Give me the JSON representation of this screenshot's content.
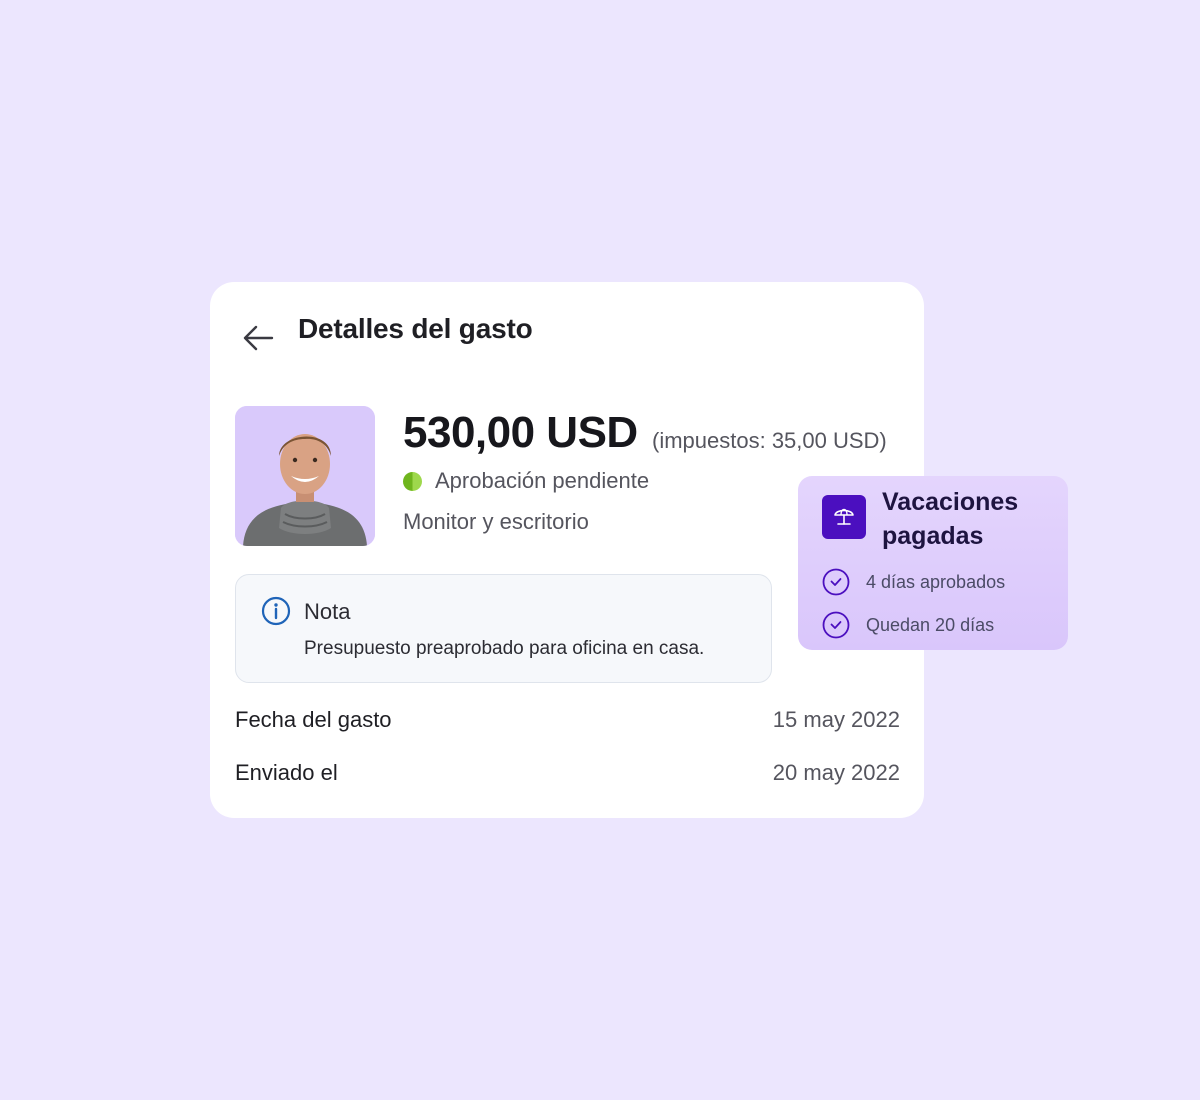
{
  "header": {
    "back_icon": "arrow-left-icon",
    "title": "Detalles del gasto"
  },
  "expense": {
    "avatar_icon": "person-avatar",
    "amount": "530,00 USD",
    "tax": "(impuestos: 35,00 USD)",
    "status": "Aprobación pendiente",
    "status_color": "#6fb51d",
    "category": "Monitor y escritorio"
  },
  "note": {
    "icon": "info-icon",
    "title": "Nota",
    "text": "Presupuesto preaprobado para oficina en casa."
  },
  "details": [
    {
      "label": "Fecha del gasto",
      "value": "15 may 2022"
    },
    {
      "label": "Enviado el",
      "value": "20 may 2022"
    }
  ],
  "vacation": {
    "icon": "beach-umbrella-icon",
    "title": "Vacaciones pagadas",
    "accent": "#4b0fbf",
    "items": [
      {
        "icon": "check-circle-icon",
        "label": "4 días aprobados"
      },
      {
        "icon": "check-circle-icon",
        "label": "Quedan 20 días"
      }
    ]
  },
  "colors": {
    "background": "#ece6fe",
    "card": "#ffffff",
    "vacation_card": "#ddcbfc"
  }
}
